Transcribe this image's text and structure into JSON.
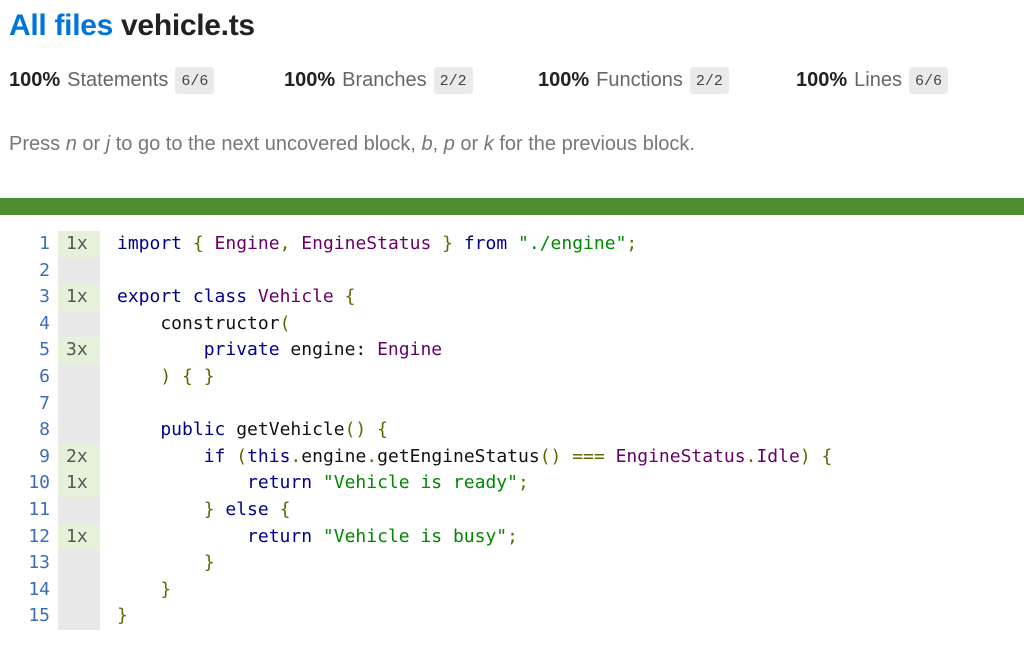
{
  "header": {
    "all_files": "All files",
    "file_name": "vehicle.ts"
  },
  "stats": [
    {
      "pct": "100%",
      "label": "Statements",
      "frac": "6/6"
    },
    {
      "pct": "100%",
      "label": "Branches",
      "frac": "2/2"
    },
    {
      "pct": "100%",
      "label": "Functions",
      "frac": "2/2"
    },
    {
      "pct": "100%",
      "label": "Lines",
      "frac": "6/6"
    }
  ],
  "help": {
    "t1": "Press ",
    "k1": "n",
    "t2": " or ",
    "k2": "j",
    "t3": " to go to the next uncovered block, ",
    "k3": "b",
    "t4": ", ",
    "k4": "p",
    "t5": " or ",
    "k5": "k",
    "t6": " for the previous block."
  },
  "colors": {
    "link": "#0074D9",
    "coverage_bar": "#4d8c2f",
    "hit_bg": "#e5f2d9"
  },
  "lines": [
    {
      "n": "1",
      "count": "1x",
      "code": [
        [
          "kw",
          "import"
        ],
        [
          "pun",
          " { "
        ],
        [
          "ty",
          "Engine"
        ],
        [
          "pun",
          ", "
        ],
        [
          "ty",
          "EngineStatus"
        ],
        [
          "pun",
          " } "
        ],
        [
          "kw",
          "from"
        ],
        [
          "pun",
          " "
        ],
        [
          "str",
          "\"./engine\""
        ],
        [
          "pun",
          ";"
        ]
      ]
    },
    {
      "n": "2",
      "count": "",
      "code": []
    },
    {
      "n": "3",
      "count": "1x",
      "code": [
        [
          "kw",
          "export class "
        ],
        [
          "ty",
          "Vehicle"
        ],
        [
          "pun",
          " {"
        ]
      ]
    },
    {
      "n": "4",
      "count": "",
      "code": [
        [
          "pl",
          "    constructor"
        ],
        [
          "pun",
          "("
        ]
      ]
    },
    {
      "n": "5",
      "count": "3x",
      "code": [
        [
          "kw",
          "        private "
        ],
        [
          "pl",
          "engine: "
        ],
        [
          "ty",
          "Engine"
        ]
      ]
    },
    {
      "n": "6",
      "count": "",
      "code": [
        [
          "pun",
          "    ) { }"
        ]
      ]
    },
    {
      "n": "7",
      "count": "",
      "code": []
    },
    {
      "n": "8",
      "count": "",
      "code": [
        [
          "kw",
          "    public "
        ],
        [
          "pl",
          "getVehicle"
        ],
        [
          "pun",
          "() {"
        ]
      ]
    },
    {
      "n": "9",
      "count": "2x",
      "code": [
        [
          "kw",
          "        if "
        ],
        [
          "pun",
          "("
        ],
        [
          "kw",
          "this"
        ],
        [
          "pun",
          "."
        ],
        [
          "pl",
          "engine"
        ],
        [
          "pun",
          "."
        ],
        [
          "pl",
          "getEngineStatus"
        ],
        [
          "pun",
          "() === "
        ],
        [
          "ty",
          "EngineStatus"
        ],
        [
          "pun",
          "."
        ],
        [
          "ty",
          "Idle"
        ],
        [
          "pun",
          ") {"
        ]
      ]
    },
    {
      "n": "10",
      "count": "1x",
      "code": [
        [
          "kw",
          "            return "
        ],
        [
          "str",
          "\"Vehicle is ready\""
        ],
        [
          "pun",
          ";"
        ]
      ]
    },
    {
      "n": "11",
      "count": "",
      "code": [
        [
          "pun",
          "        } "
        ],
        [
          "kw",
          "else"
        ],
        [
          "pun",
          " {"
        ]
      ]
    },
    {
      "n": "12",
      "count": "1x",
      "code": [
        [
          "kw",
          "            return "
        ],
        [
          "str",
          "\"Vehicle is busy\""
        ],
        [
          "pun",
          ";"
        ]
      ]
    },
    {
      "n": "13",
      "count": "",
      "code": [
        [
          "pun",
          "        }"
        ]
      ]
    },
    {
      "n": "14",
      "count": "",
      "code": [
        [
          "pun",
          "    }"
        ]
      ]
    },
    {
      "n": "15",
      "count": "",
      "code": [
        [
          "pun",
          "}"
        ]
      ]
    }
  ]
}
